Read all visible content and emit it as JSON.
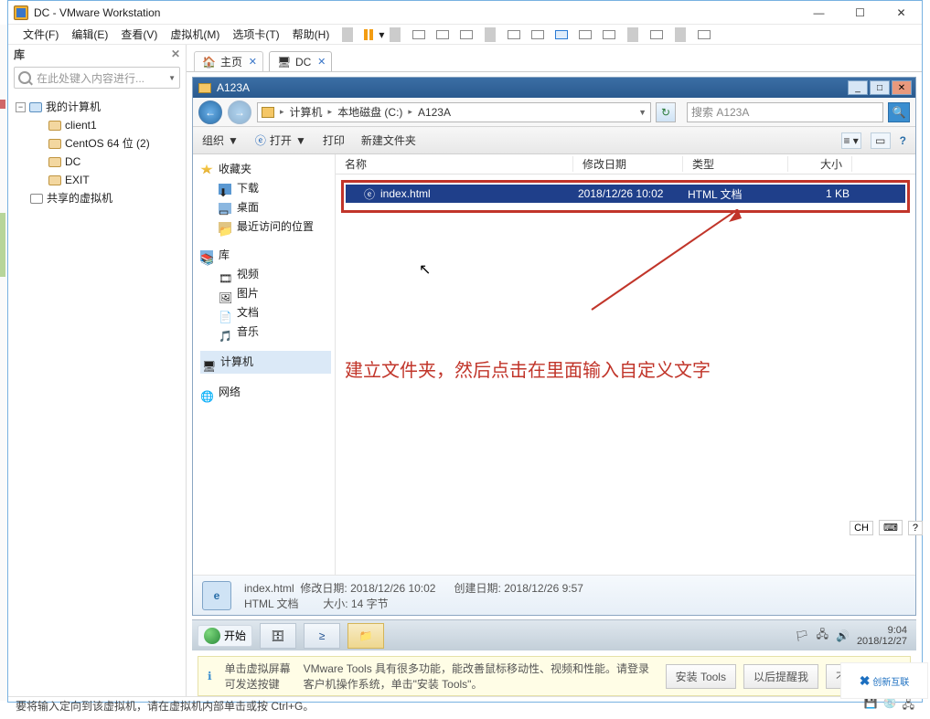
{
  "window": {
    "title": "DC - VMware Workstation",
    "menus": [
      "文件(F)",
      "编辑(E)",
      "查看(V)",
      "虚拟机(M)",
      "选项卡(T)",
      "帮助(H)"
    ]
  },
  "library": {
    "title": "库",
    "search_placeholder": "在此处键入内容进行...",
    "root": "我的计算机",
    "vms": [
      "client1",
      "CentOS 64 位 (2)",
      "DC",
      "EXIT"
    ],
    "shared": "共享的虚拟机"
  },
  "tabs": {
    "home": "主页",
    "dc": "DC"
  },
  "explorer": {
    "title": "A123A",
    "breadcrumb": [
      "计算机",
      "本地磁盘 (C:)",
      "A123A"
    ],
    "search_hint": "搜索 A123A",
    "toolbar": {
      "org": "组织",
      "open": "打开",
      "print": "打印",
      "new": "新建文件夹"
    },
    "tree": {
      "fav": "收藏夹",
      "fav_items": [
        "下载",
        "桌面",
        "最近访问的位置"
      ],
      "lib": "库",
      "lib_items": [
        "视频",
        "图片",
        "文档",
        "音乐"
      ],
      "computer": "计算机",
      "network": "网络"
    },
    "columns": {
      "name": "名称",
      "date": "修改日期",
      "type": "类型",
      "size": "大小"
    },
    "file": {
      "name": "index.html",
      "date": "2018/12/26 10:02",
      "type": "HTML 文档",
      "size": "1 KB"
    },
    "annotation": "建立文件夹，然后点击在里面输入自定义文字",
    "status": {
      "name": "index.html",
      "date_label": "修改日期:",
      "date": "2018/12/26 10:02",
      "created_label": "创建日期:",
      "created": "2018/12/26 9:57",
      "type": "HTML 文档",
      "size_label": "大小:",
      "size": "14 字节"
    }
  },
  "taskbar": {
    "start": "开始",
    "time": "9:04",
    "date": "2018/12/27"
  },
  "tip": {
    "left1": "单击虚拟屏幕",
    "left2": "可发送按键",
    "msg": "VMware Tools 具有很多功能，能改善鼠标移动性、视频和性能。请登录客户机操作系统，单击\"安装 Tools\"。",
    "btn_install": "安装 Tools",
    "btn_later": "以后提醒我",
    "btn_never": "不要提醒我"
  },
  "statusbar": "要将输入定向到该虚拟机，请在虚拟机内部单击或按 Ctrl+G。",
  "lang": {
    "ch": "CH",
    "sym": "⌨"
  },
  "watermark": "创新互联"
}
